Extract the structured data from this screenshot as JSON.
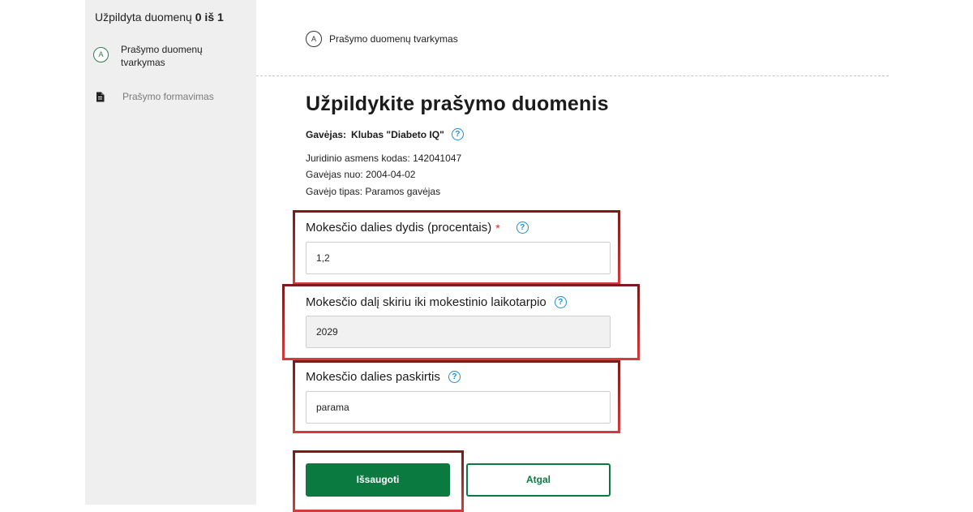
{
  "sidebar": {
    "progress_prefix": "Užpildyta duomenų",
    "progress_count": "0 iš 1",
    "steps": [
      {
        "marker": "A",
        "label": "Prašymo duomenų tvarkymas"
      },
      {
        "icon": "document-icon",
        "label": "Prašymo formavimas"
      }
    ]
  },
  "breadcrumb": {
    "marker": "A",
    "label": "Prašymo duomenų tvarkymas"
  },
  "main": {
    "title": "Užpildykite prašymo duomenis",
    "recipient_label": "Gavėjas:",
    "recipient_value": "Klubas \"Diabeto IQ\"",
    "info": [
      "Juridinio asmens kodas: 142041047",
      "Gavėjas nuo: 2004-04-02",
      "Gavėjo tipas: Paramos gavėjas"
    ]
  },
  "form": {
    "fields": [
      {
        "label": "Mokesčio dalies dydis (procentais)",
        "required_mark": "*",
        "value": "1,2"
      },
      {
        "label": "Mokesčio dalį skiriu iki mokestinio laikotarpio",
        "value": "2029"
      },
      {
        "label": "Mokesčio dalies paskirtis",
        "value": "parama"
      }
    ],
    "save_label": "Išsaugoti",
    "back_label": "Atgal"
  },
  "colors": {
    "accent_green": "#0b7a40",
    "help_blue": "#1a8fd6",
    "highlight_dark_red": "#7d1a1a",
    "highlight_red": "#d63a3a",
    "sidebar_bg": "#efefef"
  }
}
